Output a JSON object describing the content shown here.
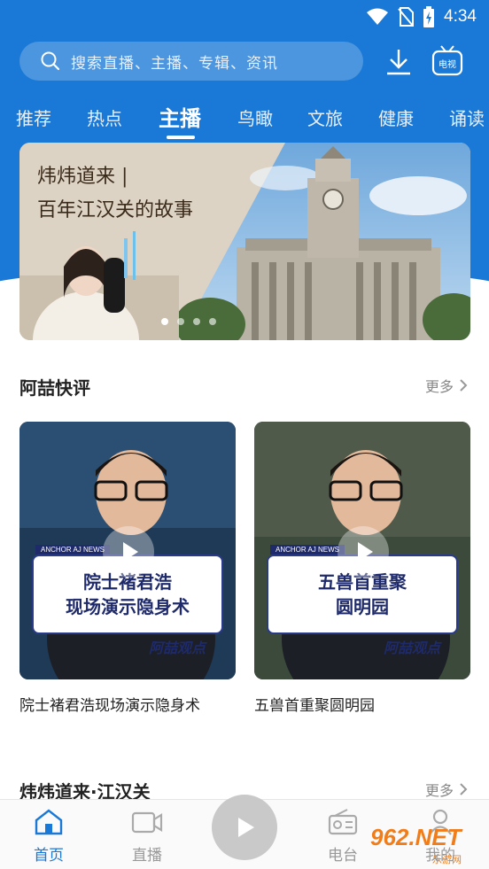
{
  "status": {
    "time": "4:34"
  },
  "search": {
    "placeholder": "搜索直播、主播、专辑、资讯"
  },
  "header": {
    "tv_label": "电视"
  },
  "tabs": [
    {
      "label": "推荐"
    },
    {
      "label": "热点"
    },
    {
      "label": "主播",
      "active": true
    },
    {
      "label": "鸟瞰"
    },
    {
      "label": "文旅"
    },
    {
      "label": "健康"
    },
    {
      "label": "诵读"
    }
  ],
  "banner": {
    "line1": "炜炜道来 |",
    "line2": "百年江汉关的故事"
  },
  "section1": {
    "title": "阿喆快评",
    "more": "更多",
    "cards": [
      {
        "tag": "ANCHOR AJ NEWS",
        "caption1": "院士褚君浩",
        "caption2": "现场演示隐身术",
        "brand": "阿喆观点",
        "title": "院士褚君浩现场演示隐身术"
      },
      {
        "tag": "ANCHOR AJ NEWS",
        "caption1": "五兽首重聚",
        "caption2": "圆明园",
        "brand": "阿喆观点",
        "title": "五兽首重聚圆明园"
      }
    ]
  },
  "section2": {
    "title": "炜炜道来·江汉关",
    "more": "更多"
  },
  "bottom_nav": [
    {
      "label": "首页",
      "icon": "home-icon",
      "active": true
    },
    {
      "label": "直播",
      "icon": "video-icon"
    },
    {
      "label": "电台",
      "icon": "radio-icon"
    },
    {
      "label": "我的",
      "icon": "user-icon"
    }
  ],
  "watermark": {
    "text": "962.NET",
    "sub": "乐游网"
  },
  "colors": {
    "brand_blue": "#1a78d6",
    "watermark": "#f07d1a"
  }
}
